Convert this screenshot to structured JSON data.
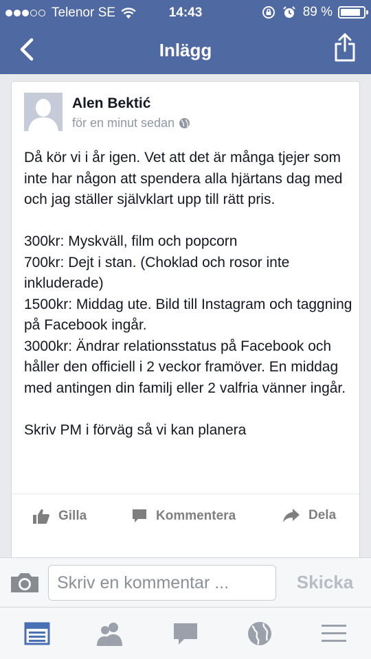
{
  "status_bar": {
    "carrier": "Telenor SE",
    "time": "14:43",
    "battery": "89 %",
    "battery_level_percent": 89
  },
  "nav": {
    "title": "Inlägg",
    "back_icon": "chevron-left-icon",
    "share_icon": "share-icon"
  },
  "post": {
    "author": "Alen Bektić",
    "time_ago": "för en minut sedan",
    "privacy_icon": "globe-icon",
    "text": "Då kör vi i år igen. Vet att det är många tjejer som inte har någon att spendera alla hjärtans dag med och jag ställer självklart upp till rätt pris.\n\n300kr: Myskväll, film och popcorn\n700kr: Dejt i stan. (Choklad och rosor inte inkluderade)\n1500kr: Middag ute. Bild till Instagram och taggning på Facebook ingår.\n3000kr: Ändrar relationsstatus på Facebook och håller den officiell i 2 veckor framöver. En middag med antingen din familj eller 2 valfria vänner ingår.\n\nSkriv PM i förväg så vi kan planera"
  },
  "actions": {
    "like": "Gilla",
    "comment": "Kommentera",
    "share": "Dela"
  },
  "comment_bar": {
    "placeholder": "Skriv en kommentar ...",
    "send": "Skicka",
    "camera_icon": "camera-icon"
  },
  "tabs": [
    {
      "icon": "news-feed-icon",
      "active": true
    },
    {
      "icon": "friends-icon",
      "active": false
    },
    {
      "icon": "messages-icon",
      "active": false
    },
    {
      "icon": "globe-icon",
      "active": false
    },
    {
      "icon": "menu-icon",
      "active": false
    }
  ],
  "colors": {
    "brand_blue": "#4f6aa3",
    "active_tab": "#4a6fb5",
    "inactive_tab": "#9ba1ab",
    "action_gray": "#7f7f7f"
  }
}
